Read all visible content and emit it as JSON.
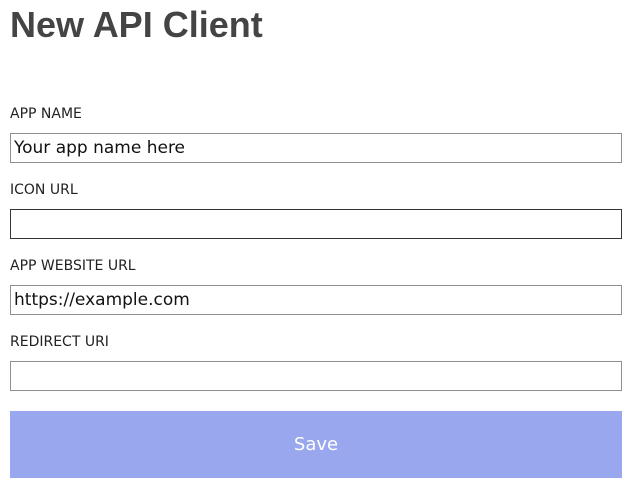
{
  "page": {
    "title": "New API Client"
  },
  "form": {
    "app_name": {
      "label": "APP NAME",
      "value": "Your app name here",
      "placeholder": ""
    },
    "icon_url": {
      "label": "ICON URL",
      "value": "",
      "placeholder": ""
    },
    "app_website_url": {
      "label": "APP WEBSITE URL",
      "value": "https://example.com",
      "placeholder": ""
    },
    "redirect_uri": {
      "label": "REDIRECT URI",
      "value": "",
      "placeholder": ""
    },
    "save_label": "Save"
  },
  "colors": {
    "save_button_bg": "#99a7ee",
    "save_button_text": "#ffffff",
    "title_text": "#444444"
  }
}
